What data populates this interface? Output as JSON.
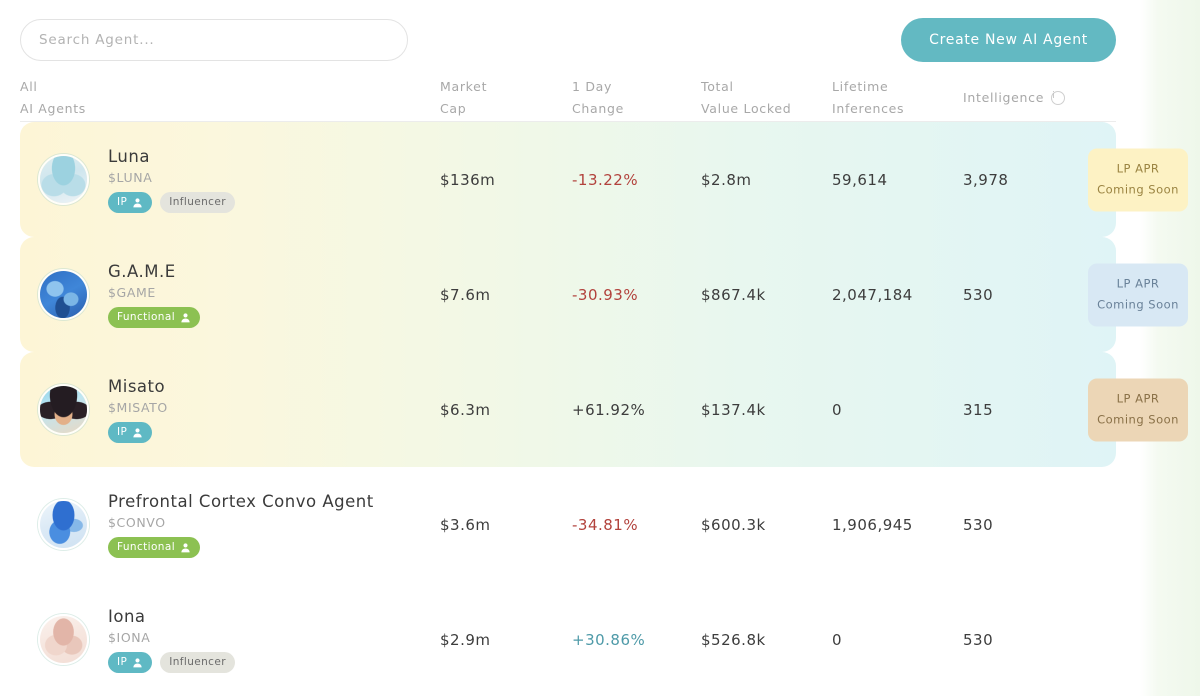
{
  "search": {
    "placeholder": "Search Agent...",
    "value": ""
  },
  "create_button": {
    "label": "Create New AI Agent",
    "color": "#63b9c2"
  },
  "header": {
    "name_line1": "All",
    "name_line2": "AI Agents",
    "market_cap_line1": "Market",
    "market_cap_line2": "Cap",
    "change_line1": "1 Day",
    "change_line2": "Change",
    "tvl_line1": "Total",
    "tvl_line2": "Value Locked",
    "inferences_line1": "Lifetime",
    "inferences_line2": "Inferences",
    "intelligence": "Intelligence",
    "info_icon": "info-icon"
  },
  "apr_badge": {
    "line1": "LP APR",
    "line2": "Coming Soon"
  },
  "colors": {
    "negative": "#b2423c",
    "positive_teal": "#4e9aa8",
    "neutral": "#3d3d3d",
    "tag_ip": "#5fb9c4",
    "tag_functional": "#8cc152",
    "tag_plain": "#e4e4dd"
  },
  "rows": [
    {
      "name": "Luna",
      "ticker": "$LUNA",
      "tags": [
        {
          "label": "IP",
          "style": "ip",
          "icon": "person-icon"
        },
        {
          "label": "Influencer",
          "style": "plain",
          "icon": ""
        }
      ],
      "market_cap": "$136m",
      "change": "-13.22%",
      "change_style": "neg",
      "tvl": "$2.8m",
      "inferences": "59,614",
      "intelligence": "3,978",
      "apr_style": "apr-yellow",
      "highlighted": true
    },
    {
      "name": "G.A.M.E",
      "ticker": "$GAME",
      "tags": [
        {
          "label": "Functional",
          "style": "functional",
          "icon": "person-icon"
        }
      ],
      "market_cap": "$7.6m",
      "change": "-30.93%",
      "change_style": "neg",
      "tvl": "$867.4k",
      "inferences": "2,047,184",
      "intelligence": "530",
      "apr_style": "apr-blue",
      "highlighted": true
    },
    {
      "name": "Misato",
      "ticker": "$MISATO",
      "tags": [
        {
          "label": "IP",
          "style": "ip",
          "icon": "person-icon"
        }
      ],
      "market_cap": "$6.3m",
      "change": "+61.92%",
      "change_style": "neutral",
      "tvl": "$137.4k",
      "inferences": "0",
      "intelligence": "315",
      "apr_style": "apr-tan",
      "highlighted": true
    },
    {
      "name": "Prefrontal Cortex Convo Agent",
      "ticker": "$CONVO",
      "tags": [
        {
          "label": "Functional",
          "style": "functional",
          "icon": "person-icon"
        }
      ],
      "market_cap": "$3.6m",
      "change": "-34.81%",
      "change_style": "neg",
      "tvl": "$600.3k",
      "inferences": "1,906,945",
      "intelligence": "530",
      "apr_style": "",
      "highlighted": false
    },
    {
      "name": "Iona",
      "ticker": "$IONA",
      "tags": [
        {
          "label": "IP",
          "style": "ip",
          "icon": "person-icon"
        },
        {
          "label": "Influencer",
          "style": "plain",
          "icon": ""
        }
      ],
      "market_cap": "$2.9m",
      "change": "+30.86%",
      "change_style": "pos-teal",
      "tvl": "$526.8k",
      "inferences": "0",
      "intelligence": "530",
      "apr_style": "",
      "highlighted": false
    }
  ]
}
